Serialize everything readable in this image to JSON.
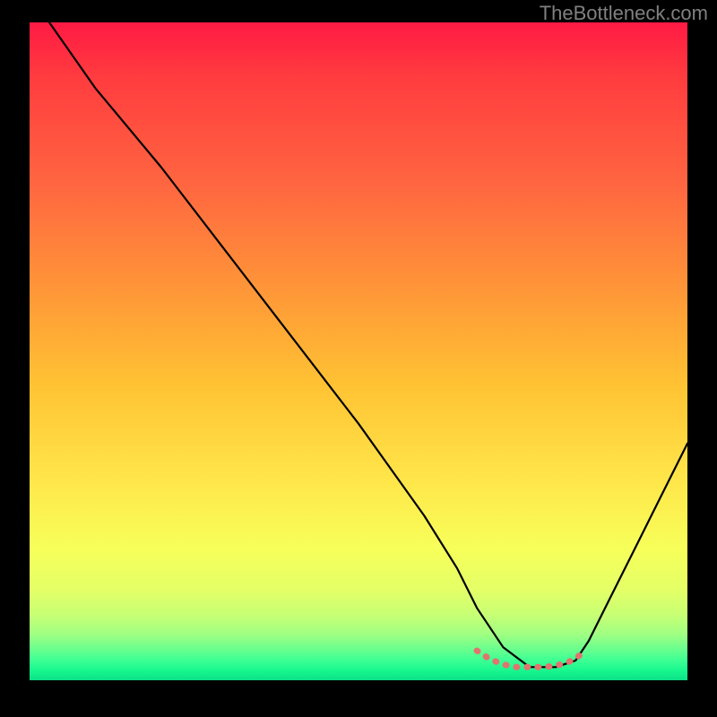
{
  "watermark": "TheBottleneck.com",
  "chart_data": {
    "type": "line",
    "title": "",
    "xlabel": "",
    "ylabel": "",
    "xlim": [
      0,
      100
    ],
    "ylim": [
      0,
      100
    ],
    "series": [
      {
        "name": "curve",
        "color": "#000000",
        "x": [
          3,
          10,
          15,
          20,
          30,
          40,
          50,
          60,
          65,
          68,
          72,
          76,
          80,
          83,
          85,
          88,
          92,
          96,
          100
        ],
        "y": [
          100,
          90,
          84,
          78,
          65,
          52,
          39,
          25,
          17,
          11,
          5,
          2,
          2,
          3,
          6,
          12,
          20,
          28,
          36
        ]
      },
      {
        "name": "optimal-band",
        "color": "#e2736f",
        "x": [
          68,
          70,
          72,
          74,
          76,
          78,
          80,
          82,
          84
        ],
        "y": [
          4.5,
          3.2,
          2.4,
          2.0,
          2.0,
          2.0,
          2.2,
          2.8,
          4.0
        ]
      }
    ],
    "background_gradient": {
      "stops": [
        {
          "pos": 0,
          "color": "#ff1a44"
        },
        {
          "pos": 0.25,
          "color": "#ff6740"
        },
        {
          "pos": 0.55,
          "color": "#ffc233"
        },
        {
          "pos": 0.8,
          "color": "#f7ff5a"
        },
        {
          "pos": 0.95,
          "color": "#70ff8c"
        },
        {
          "pos": 1.0,
          "color": "#0be088"
        }
      ]
    }
  }
}
